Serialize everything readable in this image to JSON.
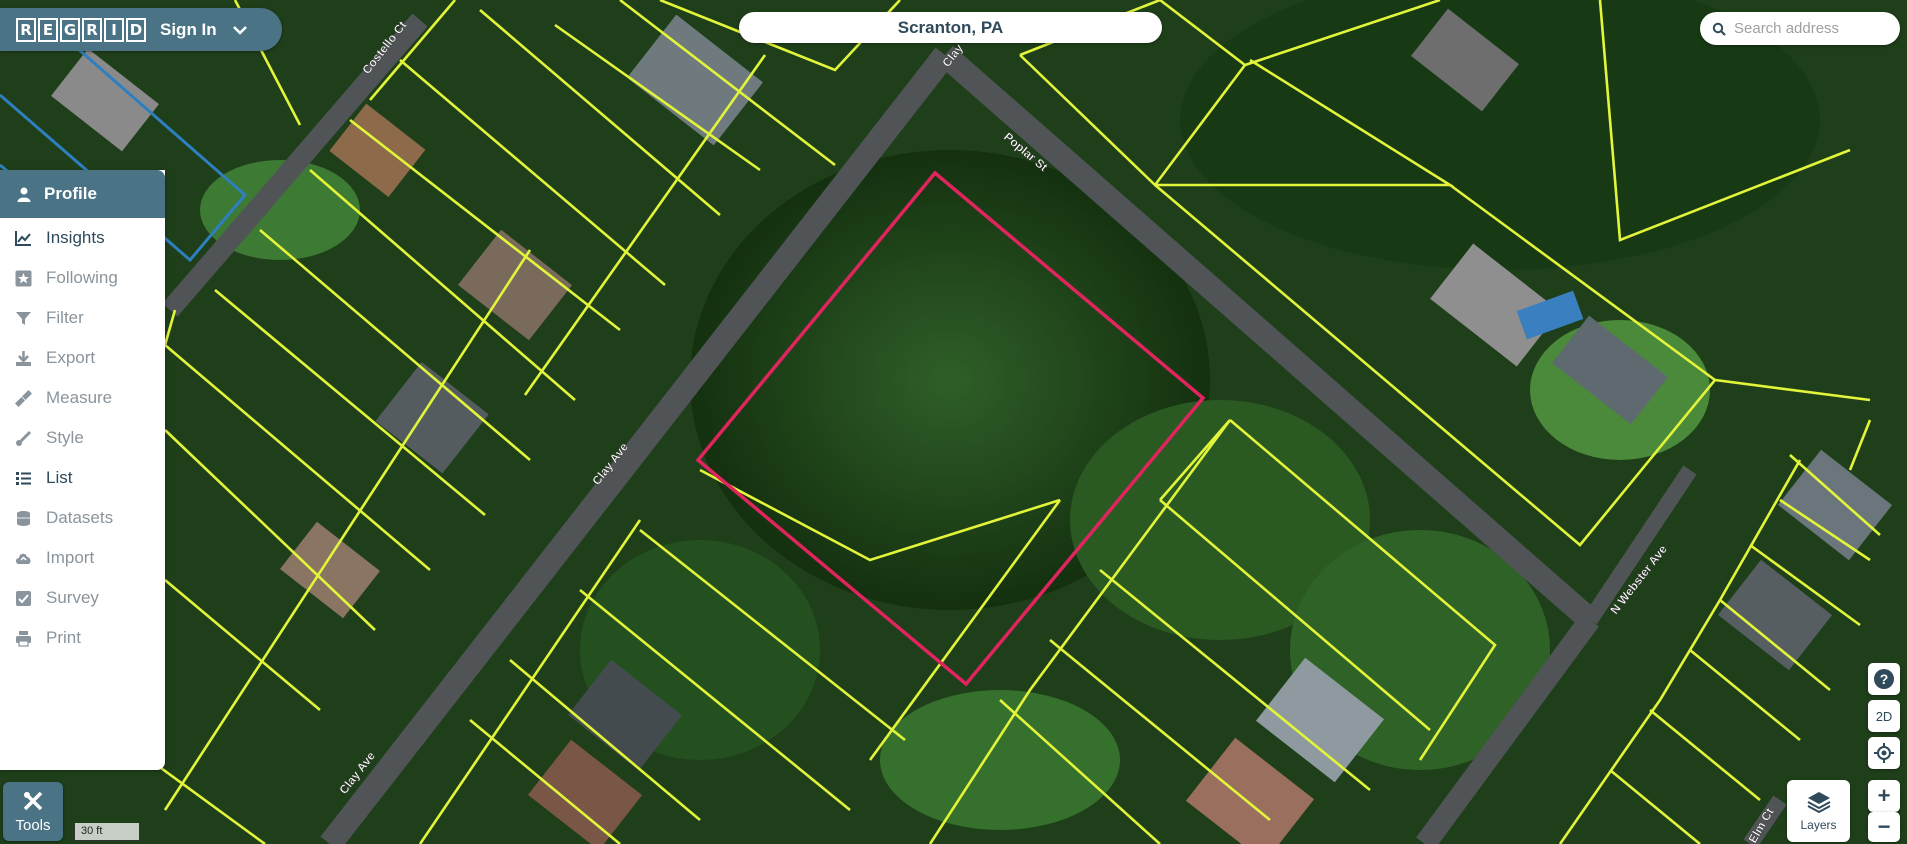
{
  "header": {
    "logo_letters": [
      "R",
      "E",
      "G",
      "R",
      "I",
      "D"
    ],
    "signin_label": "Sign In",
    "location": "Scranton, PA"
  },
  "search": {
    "placeholder": "Search address"
  },
  "sidebar": {
    "header_label": "Profile",
    "items": [
      {
        "label": "Insights",
        "icon": "chart-line-icon",
        "enabled": true
      },
      {
        "label": "Following",
        "icon": "star-icon",
        "enabled": false
      },
      {
        "label": "Filter",
        "icon": "filter-icon",
        "enabled": false
      },
      {
        "label": "Export",
        "icon": "download-icon",
        "enabled": false
      },
      {
        "label": "Measure",
        "icon": "ruler-icon",
        "enabled": false
      },
      {
        "label": "Style",
        "icon": "paintbrush-icon",
        "enabled": false
      },
      {
        "label": "List",
        "icon": "list-icon",
        "enabled": true
      },
      {
        "label": "Datasets",
        "icon": "database-icon",
        "enabled": false
      },
      {
        "label": "Import",
        "icon": "cloud-upload-icon",
        "enabled": false
      },
      {
        "label": "Survey",
        "icon": "checkbox-icon",
        "enabled": false
      },
      {
        "label": "Print",
        "icon": "printer-icon",
        "enabled": false
      }
    ]
  },
  "tools": {
    "label": "Tools"
  },
  "scale_bar": {
    "label": "30 ft"
  },
  "map_controls": {
    "help": "?",
    "view_mode": "2D",
    "zoom_in": "+",
    "zoom_out": "−",
    "layers_label": "Layers"
  },
  "street_labels": [
    "Costello Ct",
    "Clay",
    "Poplar St",
    "Clay Ave",
    "Clay Ave",
    "N Webster Ave",
    "Elm Ct"
  ],
  "colors": {
    "brand": "#4a7386",
    "parcel_outline": "#e2f53a",
    "selected_parcel": "#e0245e",
    "alt_parcel": "#2e7fbf",
    "text_dark": "#2f4a5a"
  }
}
